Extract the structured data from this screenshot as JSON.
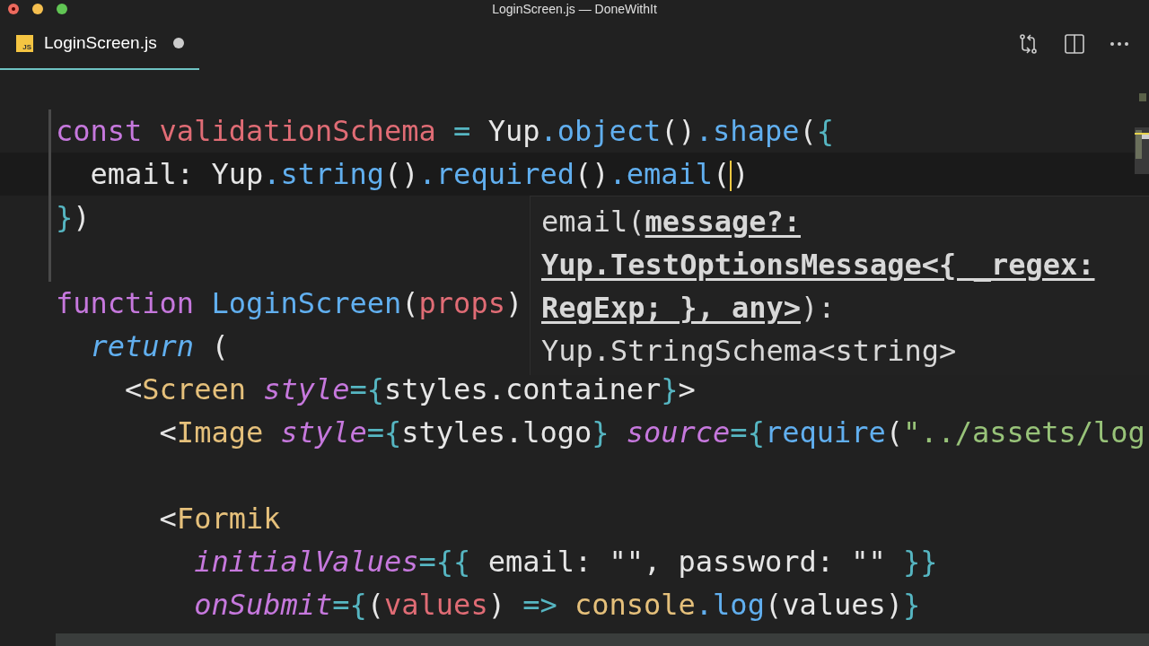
{
  "window": {
    "title": "LoginScreen.js — DoneWithIt",
    "unsaved": true
  },
  "tabs": [
    {
      "icon_text": "JS",
      "label": "LoginScreen.js",
      "selected": true,
      "modified": true
    }
  ],
  "editor": {
    "lines": [
      {
        "kind": "code",
        "tokens": [
          {
            "kind": "keyword",
            "text": "const "
          },
          {
            "kind": "variable",
            "text": "validationSchema "
          },
          {
            "kind": "operator",
            "text": "="
          },
          {
            "kind": "plain",
            "text": " Yup"
          },
          {
            "kind": "method",
            "text": ".object"
          },
          {
            "kind": "plain",
            "text": "()"
          },
          {
            "kind": "method",
            "text": ".shape"
          },
          {
            "kind": "plain",
            "text": "("
          },
          {
            "kind": "brace",
            "text": "{"
          }
        ]
      },
      {
        "kind": "code",
        "current": true,
        "tokens": [
          {
            "kind": "plain",
            "text": "  email: Yup"
          },
          {
            "kind": "method",
            "text": ".string"
          },
          {
            "kind": "plain",
            "text": "()"
          },
          {
            "kind": "method",
            "text": ".required"
          },
          {
            "kind": "plain",
            "text": "()"
          },
          {
            "kind": "method",
            "text": ".email"
          },
          {
            "kind": "plain",
            "text": "("
          },
          {
            "kind": "cursor"
          },
          {
            "kind": "plain",
            "text": ")"
          }
        ]
      },
      {
        "kind": "code",
        "tokens": [
          {
            "kind": "brace",
            "text": "}"
          },
          {
            "kind": "plain",
            "text": ")"
          }
        ]
      },
      {
        "kind": "blank"
      },
      {
        "kind": "code",
        "tokens": [
          {
            "kind": "keyword",
            "text": "function "
          },
          {
            "kind": "method",
            "text": "LoginScreen"
          },
          {
            "kind": "plain",
            "text": "("
          },
          {
            "kind": "param",
            "text": "props"
          },
          {
            "kind": "plain",
            "text": ")"
          }
        ]
      },
      {
        "kind": "code",
        "tokens": [
          {
            "kind": "control",
            "text": "  return"
          },
          {
            "kind": "plain",
            "text": " ("
          }
        ]
      },
      {
        "kind": "code",
        "tokens": [
          {
            "kind": "plain",
            "text": "    <"
          },
          {
            "kind": "tag",
            "text": "Screen "
          },
          {
            "kind": "attr",
            "text": "style"
          },
          {
            "kind": "operator",
            "text": "="
          },
          {
            "kind": "brace",
            "text": "{"
          },
          {
            "kind": "plain",
            "text": "styles.container"
          },
          {
            "kind": "brace",
            "text": "}"
          },
          {
            "kind": "plain",
            "text": ">"
          }
        ]
      },
      {
        "kind": "code",
        "tokens": [
          {
            "kind": "plain",
            "text": "      <"
          },
          {
            "kind": "tag",
            "text": "Image "
          },
          {
            "kind": "attr",
            "text": "style"
          },
          {
            "kind": "operator",
            "text": "="
          },
          {
            "kind": "brace",
            "text": "{"
          },
          {
            "kind": "plain",
            "text": "styles.logo"
          },
          {
            "kind": "brace",
            "text": "} "
          },
          {
            "kind": "attr",
            "text": "source"
          },
          {
            "kind": "operator",
            "text": "="
          },
          {
            "kind": "brace",
            "text": "{"
          },
          {
            "kind": "method",
            "text": "require"
          },
          {
            "kind": "plain",
            "text": "("
          },
          {
            "kind": "string",
            "text": "\"../assets/log"
          }
        ]
      },
      {
        "kind": "blank"
      },
      {
        "kind": "code",
        "tokens": [
          {
            "kind": "plain",
            "text": "      <"
          },
          {
            "kind": "tag",
            "text": "Formik"
          }
        ]
      },
      {
        "kind": "code",
        "tokens": [
          {
            "kind": "attr",
            "text": "        initialValues"
          },
          {
            "kind": "operator",
            "text": "="
          },
          {
            "kind": "brace",
            "text": "{{"
          },
          {
            "kind": "plain",
            "text": " email: \"\", password: \"\" "
          },
          {
            "kind": "brace",
            "text": "}}"
          }
        ]
      },
      {
        "kind": "code",
        "tokens": [
          {
            "kind": "attr",
            "text": "        onSubmit"
          },
          {
            "kind": "operator",
            "text": "="
          },
          {
            "kind": "brace",
            "text": "{"
          },
          {
            "kind": "plain",
            "text": "("
          },
          {
            "kind": "param",
            "text": "values"
          },
          {
            "kind": "plain",
            "text": ") "
          },
          {
            "kind": "operator",
            "text": "=> "
          },
          {
            "kind": "class",
            "text": "console"
          },
          {
            "kind": "method",
            "text": ".log"
          },
          {
            "kind": "plain",
            "text": "(values)"
          },
          {
            "kind": "brace",
            "text": "}"
          }
        ]
      }
    ]
  },
  "hover": {
    "prefix": "email(",
    "parameter": "message?: Yup.TestOptionsMessage<{ _regex: RegExp; }, any>",
    "suffix": "): Yup.StringSchema<string>"
  }
}
